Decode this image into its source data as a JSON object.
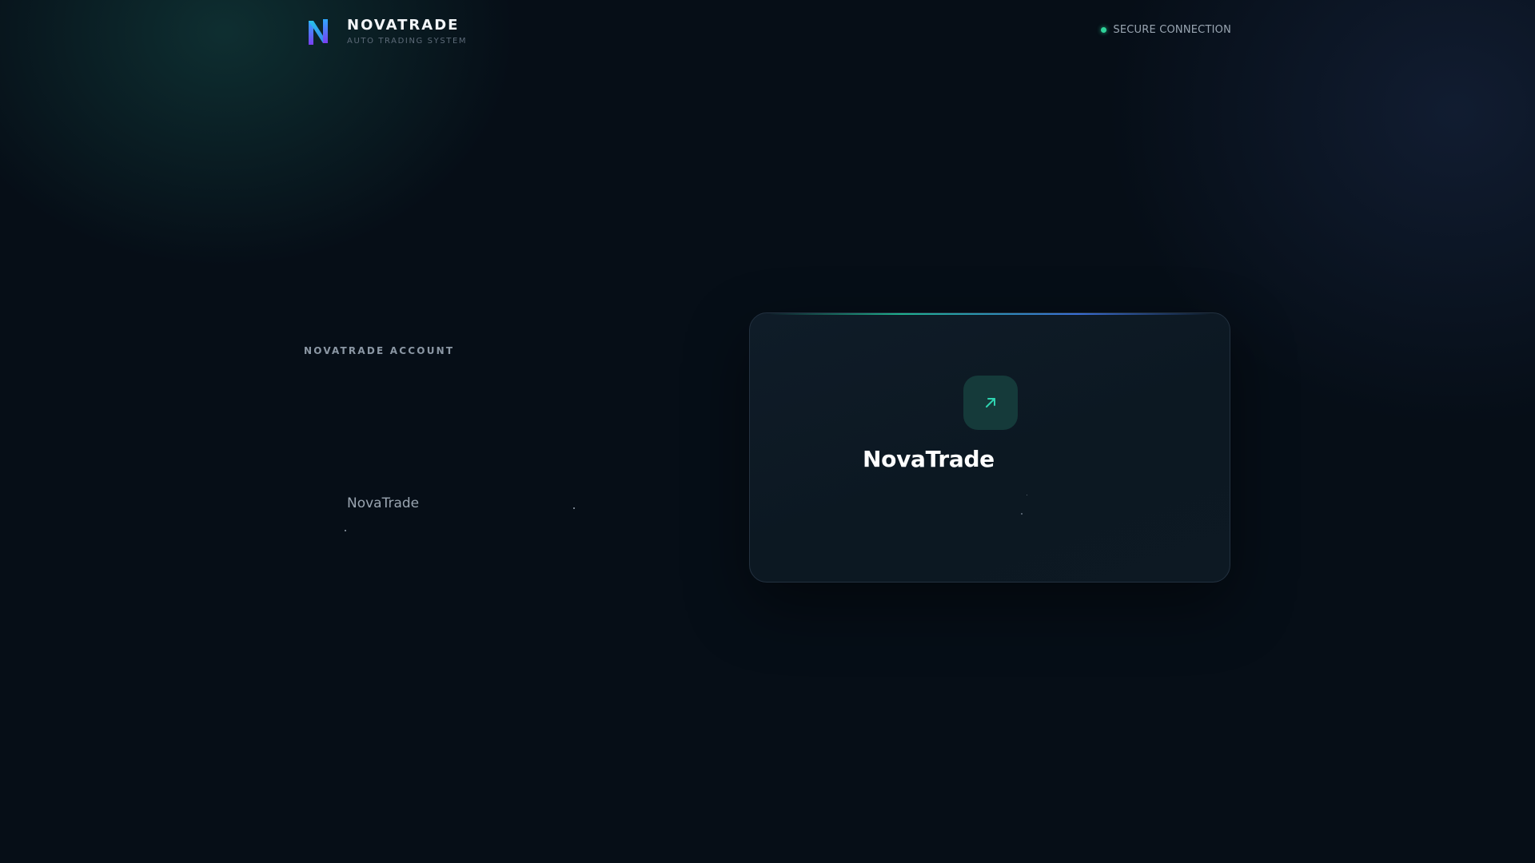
{
  "header": {
    "brand_name": "NOVATRADE",
    "brand_tagline": "AUTO TRADING SYSTEM",
    "status_text": "SECURE CONNECTION",
    "logo_icon": "novatrade-logo-icon"
  },
  "left": {
    "account_label": "NOVATRADE ACCOUNT",
    "brand_text": "NovaTrade"
  },
  "card": {
    "icon": "arrow-up-right-icon",
    "title": "NovaTrade"
  },
  "colors": {
    "background": "#060e17",
    "accent_teal": "#1fb28f",
    "accent_blue": "#3b6fd8",
    "status_green": "#2fd39a",
    "card_background": "#0f1c28"
  }
}
